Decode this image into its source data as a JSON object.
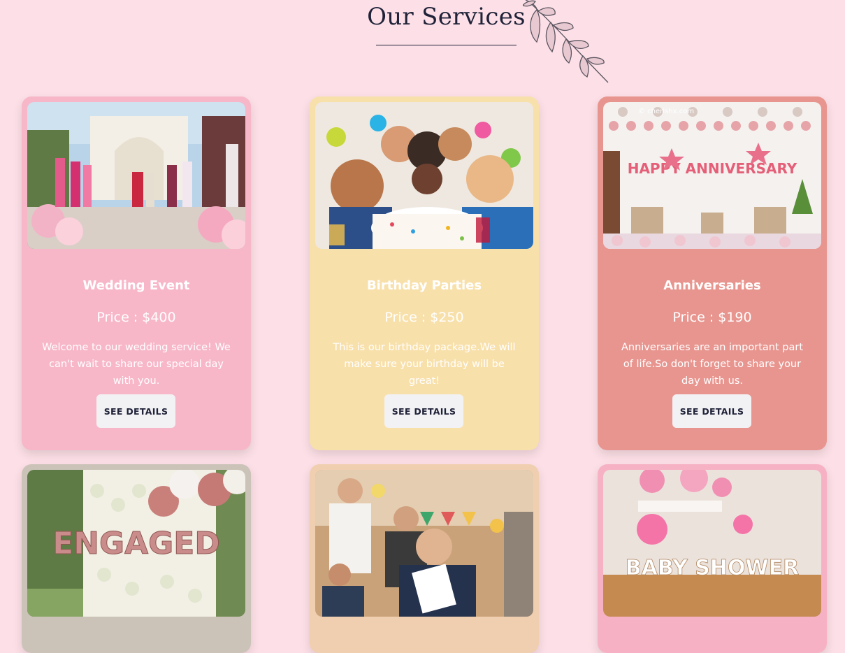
{
  "header": {
    "title": "Our Services"
  },
  "services": [
    {
      "title": "Wedding Event",
      "price": "Price : $400",
      "description": "Welcome to our wedding service! We can't wait to share our special day with you.",
      "button": "SEE DETAILS",
      "card_color": "#f7b7c9"
    },
    {
      "title": "Birthday Parties",
      "price": "Price : $250",
      "description": "This is our birthday package.We will make sure your birthday will be great!",
      "button": "SEE DETAILS",
      "card_color": "#f8e0ab"
    },
    {
      "title": "Anniversaries",
      "price": "Price : $190",
      "description": "Anniversaries are an important part of life.So don't forget to share your day with us.",
      "button": "SEE DETAILS",
      "card_color": "#e8958f",
      "image_watermark": "© cherishx.com",
      "image_text": "HAPPY ANNIVERSARY"
    },
    {
      "card_color": "#cbc3b8",
      "image_text": "ENGAGED"
    },
    {
      "card_color": "#f0cfb0"
    },
    {
      "card_color": "#f7b1c5",
      "image_text": "BABY SHOWER"
    }
  ]
}
